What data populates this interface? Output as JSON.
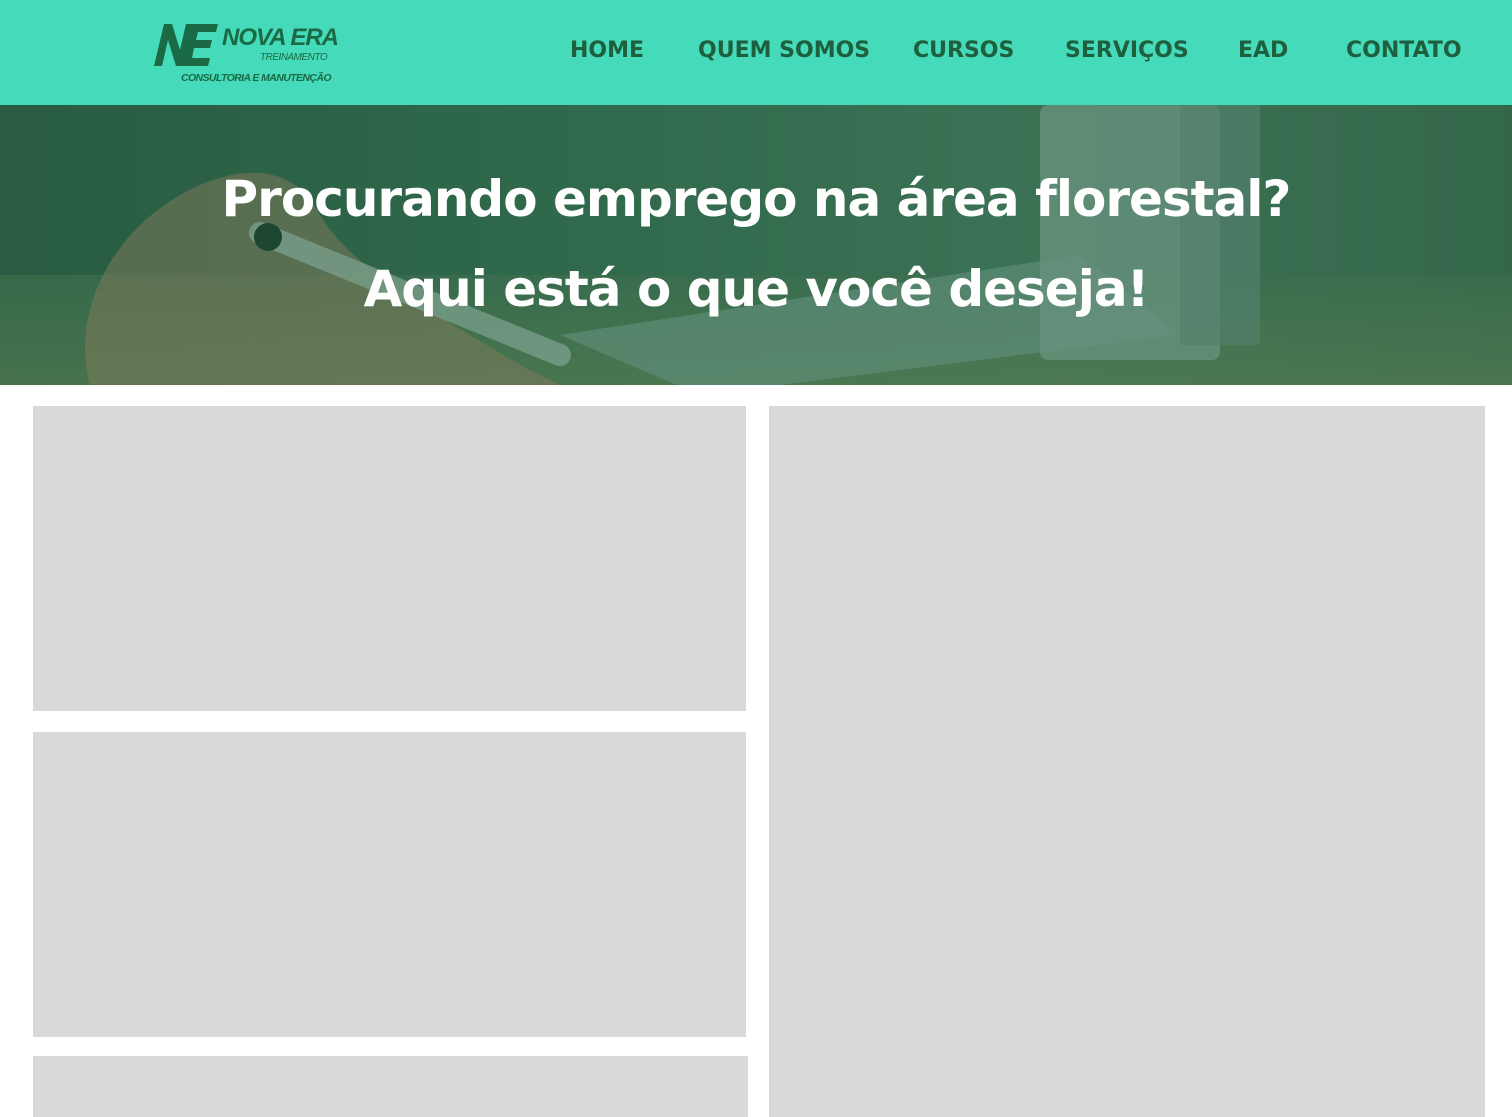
{
  "header": {
    "logo": {
      "title": "NOVA ERA",
      "subtitle": "TREINAMENTO",
      "tagline": "CONSULTORIA E MANUTENÇÃO"
    },
    "nav": [
      {
        "label": "HOME"
      },
      {
        "label": "QUEM SOMOS"
      },
      {
        "label": "CURSOS"
      },
      {
        "label": "SERVIÇOS"
      },
      {
        "label": "EAD"
      },
      {
        "label": "CONTATO"
      }
    ]
  },
  "hero": {
    "line1": "Procurando emprego na área florestal?",
    "line2": "Aqui está o que você deseja!"
  },
  "colors": {
    "header_bg": "#45dab9",
    "nav_text": "#1e5f3e",
    "logo_green": "#1a6b45",
    "card_placeholder": "#d9d9d9"
  }
}
